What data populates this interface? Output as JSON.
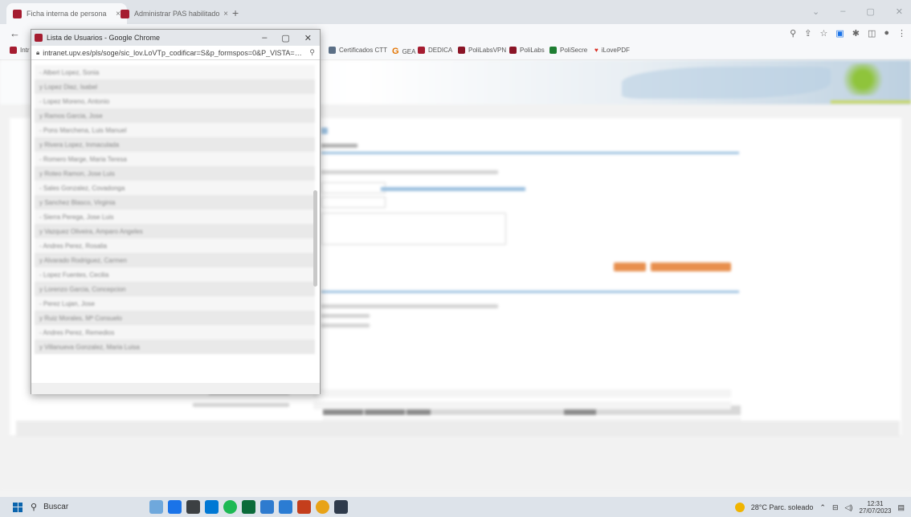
{
  "browser": {
    "tabs": [
      {
        "label": "Ficha interna de persona",
        "close": "×"
      },
      {
        "label": "Administrar PAS habilitado",
        "close": "×"
      }
    ],
    "new_tab": "+",
    "window_controls": [
      "⌄",
      "–",
      "▢",
      "✕"
    ],
    "bookmarks": [
      "Intr",
      "Certificados CTT",
      "GEA",
      "DEDICA",
      "PoliLabsVPN",
      "PoliLabs",
      "PoliSecre",
      "iLovePDF"
    ]
  },
  "popup": {
    "title": "Lista de Usuarios - Google Chrome",
    "url": "intranet.upv.es/pls/soge/sic_lov.LoVTp_codificar=S&p_formspos=0&P_VISTA=MS&p...",
    "controls": [
      "–",
      "▢",
      "✕"
    ],
    "users": [
      "- Albert Lopez, Sonia",
      "y Lopez Diaz, Isabel",
      "- Lopez Moreno, Antonio",
      "y Ramos Garcia, Jose",
      "- Pons Marchena, Luis Manuel",
      "y Rivera Lopez, Inmaculada",
      "- Romero Marge, Maria Teresa",
      "y Roteo Ramon, Jose Luis",
      "- Sales Gonzalez, Covadonga",
      "y Sanchez Blasco, Virginia",
      "- Sierra Perega, Jose Luis",
      "y Vazquez Oliveira, Amparo Angeles",
      "- Andres Perez, Rosalia",
      "y Alvarado Rodriguez, Carmen",
      "- Lopez Fuentes, Cecilia",
      "y Lorenzo Garcia, Concepcion",
      "- Perez Lujan, Jose",
      "y Ruiz Morales, Mª Consuelo",
      "- Andres Perez, Remedios",
      "y Villanueva Gonzalez, Maria Luisa"
    ]
  },
  "taskbar": {
    "search_label": "Buscar",
    "weather": "28°C  Parc. soleado",
    "time": "12:31",
    "date": "27/07/2023"
  }
}
